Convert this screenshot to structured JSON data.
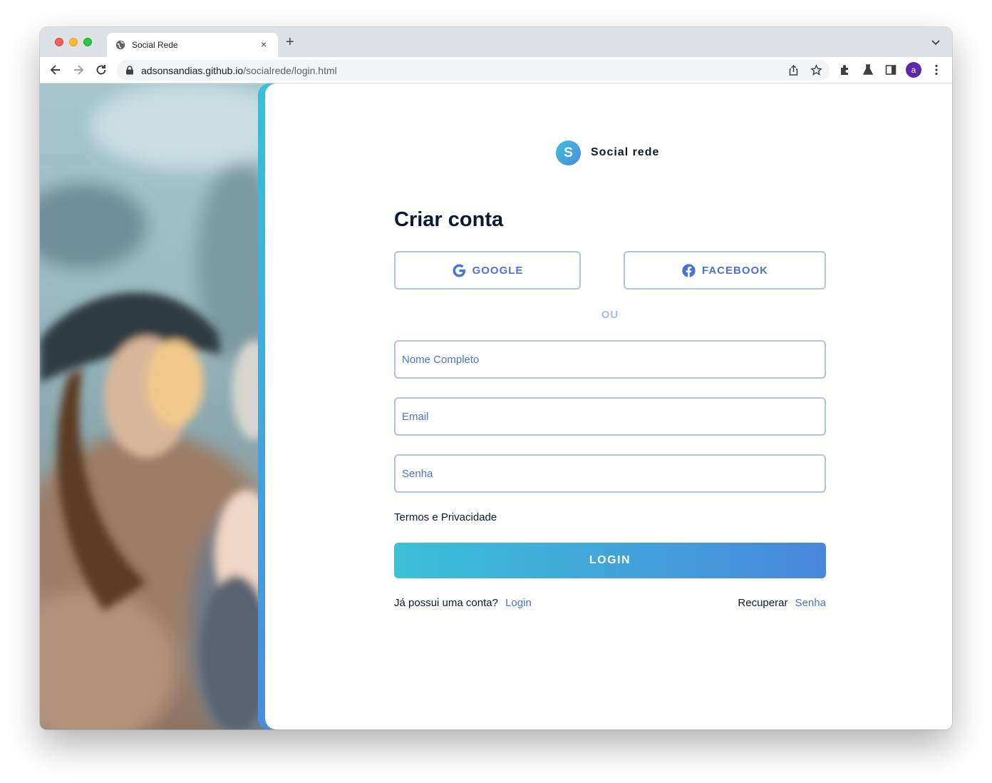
{
  "browser": {
    "tab_title": "Social Rede",
    "tab_close": "×",
    "new_tab": "+",
    "url_host": "adsonsandias.github.io",
    "url_path": "/socialrede/login.html",
    "profile_initial": "a",
    "profile_color": "#5b2aa6",
    "icons": [
      "back-arrow-icon",
      "forward-arrow-icon",
      "reload-icon",
      "lock-icon",
      "share-icon",
      "star-icon",
      "extensions-icon",
      "labs-icon",
      "side-panel-icon",
      "more-menu-icon"
    ]
  },
  "brand": {
    "logo_letter": "S",
    "name": "Social rede"
  },
  "form": {
    "heading": "Criar conta",
    "google_label": "GOOGLE",
    "facebook_label": "FACEBOOK",
    "divider": "OU",
    "name_placeholder": "Nome Completo",
    "email_placeholder": "Email",
    "password_placeholder": "Senha",
    "terms": "Termos e Privacidade",
    "submit_label": "LOGIN"
  },
  "footer": {
    "have_account": "Já possui uma conta?",
    "login_link": "Login",
    "recover": "Recuperar",
    "password_link": "Senha"
  },
  "colors": {
    "accent_start": "#3bc1d6",
    "accent_end": "#4888dc",
    "link": "#4a74cf",
    "heading": "#0b1a33",
    "border": "#b3c2dd"
  }
}
